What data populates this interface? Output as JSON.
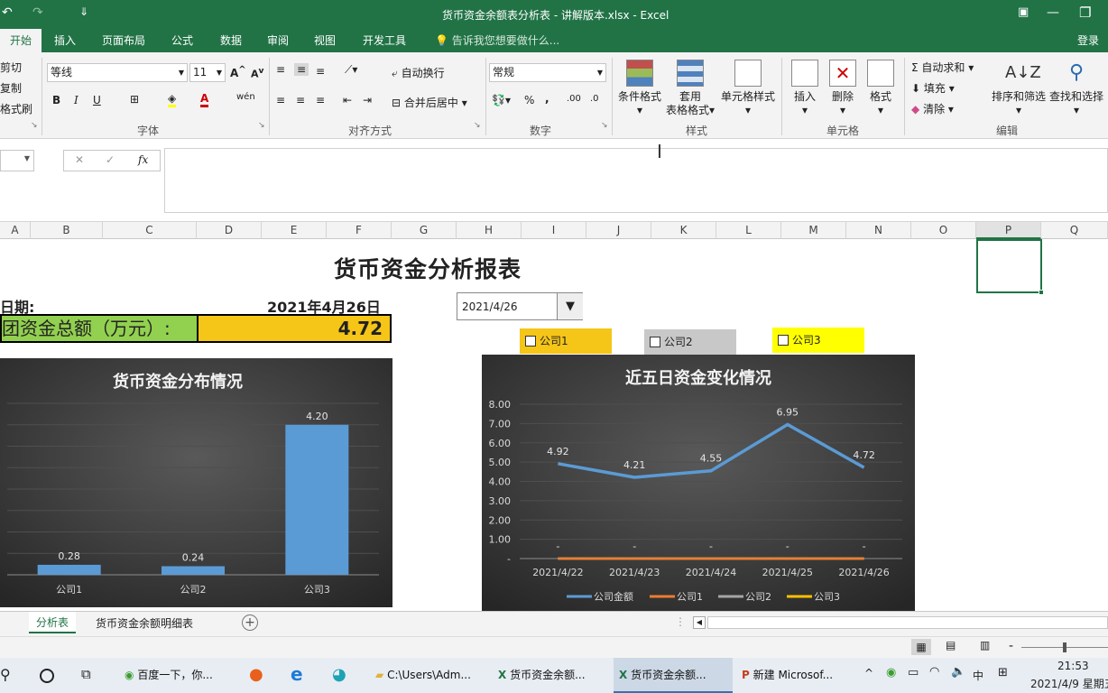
{
  "window": {
    "title": "货币资金余额表分析表 - 讲解版本.xlsx - Excel"
  },
  "tabs": [
    "开始",
    "插入",
    "页面布局",
    "公式",
    "数据",
    "审阅",
    "视图",
    "开发工具"
  ],
  "tell_me": "告诉我您想要做什么...",
  "login": "登录",
  "ribbon": {
    "clipboard": {
      "cut": "剪切",
      "copy": "复制",
      "format_painter": "格式刷"
    },
    "font": {
      "name": "等线",
      "size": "11",
      "group": "字体"
    },
    "alignment": {
      "wrap": "自动换行",
      "merge": "合并后居中",
      "group": "对齐方式"
    },
    "number": {
      "format": "常规",
      "group": "数字"
    },
    "styles": {
      "conditional": "条件格式",
      "table1": "套用",
      "table2": "表格格式",
      "cell_styles": "单元格样式",
      "group": "样式"
    },
    "cells": {
      "insert": "插入",
      "delete": "删除",
      "format": "格式",
      "group": "单元格"
    },
    "editing": {
      "autosum": "自动求和",
      "fill": "填充",
      "clear": "清除",
      "sort": "排序和筛选",
      "find": "查找和选择",
      "group": "编辑"
    }
  },
  "columns": [
    "A",
    "B",
    "C",
    "D",
    "E",
    "F",
    "G",
    "H",
    "I",
    "J",
    "K",
    "L",
    "M",
    "N",
    "O",
    "P",
    "Q"
  ],
  "sheet": {
    "report_title": "货币资金分析报表",
    "date_label": "日期:",
    "date_value": "2021年4月26日",
    "total_label": "团资金总额（万元）:",
    "total_value": "4.72",
    "dropdown_value": "2021/4/26",
    "checkboxes": [
      {
        "label": "公司1",
        "color": "#f5c518"
      },
      {
        "label": "公司2",
        "color": "#c8c8c8"
      },
      {
        "label": "公司3",
        "color": "#ffff00"
      }
    ]
  },
  "sheet_tabs": [
    "分析表",
    "货币资金余额明细表"
  ],
  "taskbar": {
    "items": [
      "百度一下，你...",
      "C:\\Users\\Adm...",
      "货币资金余额...",
      "货币资金余额...",
      "新建 Microsof..."
    ],
    "ime": "中",
    "time": "21:53",
    "date": "2021/4/9 星期五"
  },
  "chart_data": [
    {
      "type": "bar",
      "title": "货币资金分布情况",
      "categories": [
        "公司1",
        "公司2",
        "公司3"
      ],
      "values": [
        0.28,
        0.24,
        4.2
      ],
      "data_labels": [
        "0.28",
        "0.24",
        "4.20"
      ],
      "ylim": [
        0,
        4.8
      ],
      "grid": true,
      "color": "#5b9bd5"
    },
    {
      "type": "line",
      "title": "近五日资金变化情况",
      "x": [
        "2021/4/22",
        "2021/4/23",
        "2021/4/24",
        "2021/4/25",
        "2021/4/26"
      ],
      "y_ticks": [
        "8.00",
        "7.00",
        "6.00",
        "5.00",
        "4.00",
        "3.00",
        "2.00",
        "1.00",
        "-"
      ],
      "ylim": [
        0,
        8
      ],
      "grid": true,
      "legend_position": "bottom",
      "series": [
        {
          "name": "公司金额",
          "values": [
            4.92,
            4.21,
            4.55,
            6.95,
            4.72
          ],
          "labels": [
            "4.92",
            "4.21",
            "4.55",
            "6.95",
            "4.72"
          ],
          "color": "#5b9bd5"
        },
        {
          "name": "公司1",
          "values": [
            0,
            0,
            0,
            0,
            0
          ],
          "labels": [
            "-",
            "-",
            "-",
            "-",
            "-"
          ],
          "color": "#ed7d31"
        },
        {
          "name": "公司2",
          "values": [
            0,
            0,
            0,
            0,
            0
          ],
          "color": "#a5a5a5"
        },
        {
          "name": "公司3",
          "values": [
            0,
            0,
            0,
            0,
            0
          ],
          "color": "#ffc000"
        }
      ]
    }
  ]
}
